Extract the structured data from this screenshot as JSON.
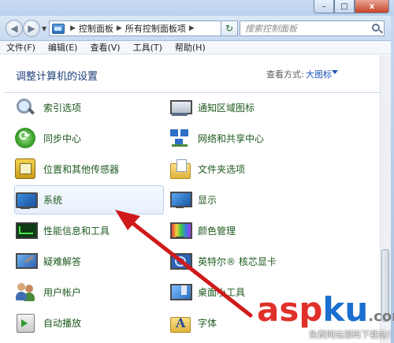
{
  "window": {
    "min_label": "–",
    "max_label": "□",
    "close_label": "x"
  },
  "address": {
    "breadcrumbs": [
      "控制面板",
      "所有控制面板项"
    ],
    "search_placeholder": "搜索控制面板"
  },
  "menu": [
    "文件(F)",
    "编辑(E)",
    "查看(V)",
    "工具(T)",
    "帮助(H)"
  ],
  "content": {
    "heading": "调整计算机的设置",
    "view_by_label": "查看方式:",
    "view_by_value": "大图标"
  },
  "items_left": [
    {
      "label": "索引选项",
      "icon": "magnify-icon"
    },
    {
      "label": "同步中心",
      "icon": "sync-icon"
    },
    {
      "label": "位置和其他传感器",
      "icon": "sensor-icon"
    },
    {
      "label": "系统",
      "icon": "monitor-icon"
    },
    {
      "label": "性能信息和工具",
      "icon": "perf-icon"
    },
    {
      "label": "疑难解答",
      "icon": "troubleshoot-icon"
    },
    {
      "label": "用户帐户",
      "icon": "users-icon"
    },
    {
      "label": "自动播放",
      "icon": "autoplay-icon"
    }
  ],
  "items_right": [
    {
      "label": "通知区域图标",
      "icon": "notify-icon"
    },
    {
      "label": "网络和共享中心",
      "icon": "network-icon"
    },
    {
      "label": "文件夹选项",
      "icon": "folder-icon"
    },
    {
      "label": "显示",
      "icon": "display-icon"
    },
    {
      "label": "颜色管理",
      "icon": "color-icon"
    },
    {
      "label": "英特尔® 核芯显卡",
      "icon": "intel-icon"
    },
    {
      "label": "桌面小工具",
      "icon": "gadget-icon"
    },
    {
      "label": "字体",
      "icon": "font-icon"
    }
  ],
  "watermark": {
    "brand_a": "asp",
    "brand_b": "ku",
    "brand_c": ".com",
    "sub": "免费网站源码下载站！"
  },
  "colors": {
    "link_green": "#1e5a1e",
    "heading_blue": "#1e3f7a",
    "arrow_red": "#d01a1a"
  }
}
